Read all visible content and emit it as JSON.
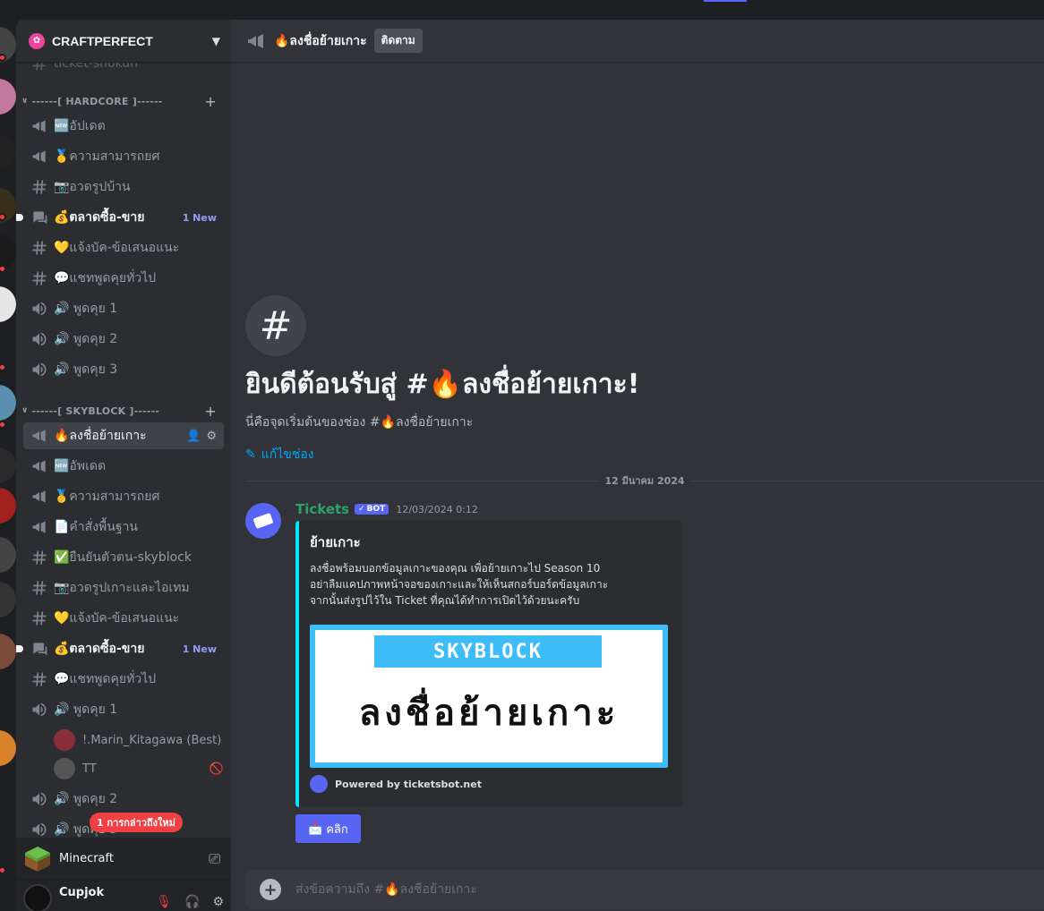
{
  "server": {
    "name": "CRAFTPERFECT",
    "icon": "flower-icon"
  },
  "sidebar": {
    "top_partial": "ticket-shokun",
    "categories": [
      {
        "name": "------[ HARDCORE ]------"
      },
      {
        "name": "------[ SKYBLOCK ]------"
      }
    ],
    "hardcore": [
      {
        "label": "🆕อัปเดต",
        "type": "announcement"
      },
      {
        "label": "🥇ความสามารถยศ",
        "type": "announcement"
      },
      {
        "label": "📷อวดรูปบ้าน",
        "type": "text"
      },
      {
        "label": "💰ตลาดซื้อ-ขาย",
        "type": "forum",
        "badge": "1 New"
      },
      {
        "label": "💛แจ้งบัค-ข้อเสนอแนะ",
        "type": "text"
      },
      {
        "label": "💬แชทพูดคุยทั่วไป",
        "type": "text"
      },
      {
        "label": "🔊 พูดคุย 1",
        "type": "voice"
      },
      {
        "label": "🔊 พูดคุย 2",
        "type": "voice"
      },
      {
        "label": "🔊 พูดคุย 3",
        "type": "voice"
      }
    ],
    "skyblock": [
      {
        "label": "🔥ลงชื่อย้ายเกาะ",
        "type": "announcement"
      },
      {
        "label": "🆕อัพเดต",
        "type": "announcement"
      },
      {
        "label": "🥇ความสามารถยศ",
        "type": "announcement"
      },
      {
        "label": "📄คำสั่งพื้นฐาน",
        "type": "announcement"
      },
      {
        "label": "✅ยืนยันตัวตน-skyblock",
        "type": "text"
      },
      {
        "label": "📷อวดรูปเกาะและไอเทม",
        "type": "text"
      },
      {
        "label": "💛แจ้งบัค-ข้อเสนอแนะ",
        "type": "text"
      },
      {
        "label": "💰ตลาดซื้อ-ขาย",
        "type": "forum",
        "badge": "1 New"
      },
      {
        "label": "💬แชทพูดคุยทั่วไป",
        "type": "text"
      },
      {
        "label": "🔊 พูดคุย 1",
        "type": "voice"
      },
      {
        "label": "🔊 พูดคุย 2",
        "type": "voice"
      },
      {
        "label": "🔊 พูดคุย 3",
        "type": "voice"
      }
    ],
    "voice_users": [
      {
        "name": "!.Marin_Kitagawa (Best)"
      },
      {
        "name": "TT"
      }
    ],
    "mention_pill": "1 การกล่าวถึงใหม่"
  },
  "activity": {
    "name": "Minecraft"
  },
  "user": {
    "name": "Cupjok"
  },
  "channel": {
    "title": "🔥ลงชื่อย้ายเกาะ",
    "follow_label": "ติดตาม",
    "welcome_title": "ยินดีต้อนรับสู่ #🔥ลงชื่อย้ายเกาะ!",
    "welcome_sub": "นี่คือจุดเริ่มต้นของช่อง #🔥ลงชื่อย้ายเกาะ",
    "edit_label": "แก้ไขช่อง",
    "date_separator": "12 มีนาคม 2024"
  },
  "message": {
    "author": "Tickets",
    "bot_label": "BOT",
    "timestamp": "12/03/2024 0:12",
    "embed": {
      "title": "ย้ายเกาะ",
      "line1": "ลงชื่อพร้อมบอกข้อมูลเกาะของคุณ เพื่อย้ายเกาะไป Season 10",
      "line2": "อย่าลืมแคปภาพหน้าจอของเกาะและให้เห็นสกอร์บอร์ดข้อมูลเกาะ",
      "line3": "จากนั้นส่งรูปไว้ใน Ticket ที่คุณได้ทำการเปิดไว้ด้วยนะครับ",
      "image_tag": "SKYBLOCK",
      "image_text": "ลงชื่อย้ายเกาะ",
      "footer": "Powered by ticketsbot.net",
      "accent_color": "#00e5ff"
    },
    "button_label": "คลิก"
  },
  "composer": {
    "placeholder": "ส่งข้อความถึง #🔥ลงชื่อย้ายเกาะ"
  },
  "colors": {
    "blurple": "#5865f2",
    "bg_main": "#313338",
    "bg_sidebar": "#2b2d31",
    "mention_red": "#f23f43",
    "bot_name": "#2ba36b"
  }
}
